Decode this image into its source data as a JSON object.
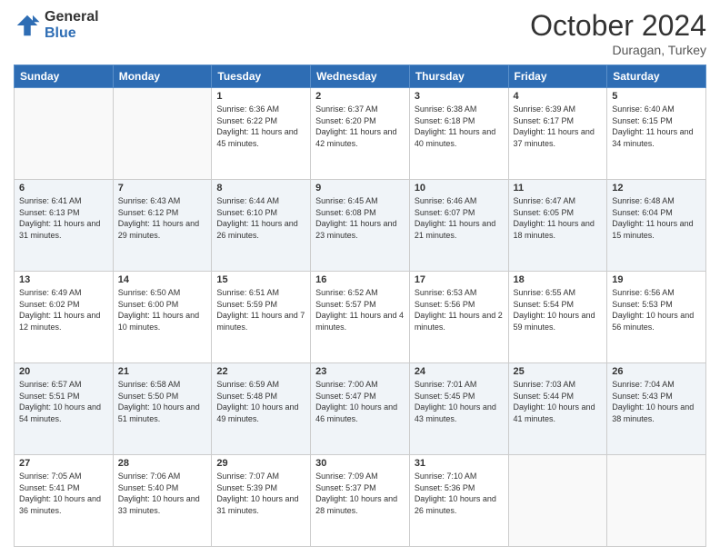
{
  "header": {
    "logo_general": "General",
    "logo_blue": "Blue",
    "title": "October 2024",
    "location": "Duragan, Turkey"
  },
  "days_of_week": [
    "Sunday",
    "Monday",
    "Tuesday",
    "Wednesday",
    "Thursday",
    "Friday",
    "Saturday"
  ],
  "weeks": [
    [
      {
        "day": "",
        "sunrise": "",
        "sunset": "",
        "daylight": ""
      },
      {
        "day": "",
        "sunrise": "",
        "sunset": "",
        "daylight": ""
      },
      {
        "day": "1",
        "sunrise": "Sunrise: 6:36 AM",
        "sunset": "Sunset: 6:22 PM",
        "daylight": "Daylight: 11 hours and 45 minutes."
      },
      {
        "day": "2",
        "sunrise": "Sunrise: 6:37 AM",
        "sunset": "Sunset: 6:20 PM",
        "daylight": "Daylight: 11 hours and 42 minutes."
      },
      {
        "day": "3",
        "sunrise": "Sunrise: 6:38 AM",
        "sunset": "Sunset: 6:18 PM",
        "daylight": "Daylight: 11 hours and 40 minutes."
      },
      {
        "day": "4",
        "sunrise": "Sunrise: 6:39 AM",
        "sunset": "Sunset: 6:17 PM",
        "daylight": "Daylight: 11 hours and 37 minutes."
      },
      {
        "day": "5",
        "sunrise": "Sunrise: 6:40 AM",
        "sunset": "Sunset: 6:15 PM",
        "daylight": "Daylight: 11 hours and 34 minutes."
      }
    ],
    [
      {
        "day": "6",
        "sunrise": "Sunrise: 6:41 AM",
        "sunset": "Sunset: 6:13 PM",
        "daylight": "Daylight: 11 hours and 31 minutes."
      },
      {
        "day": "7",
        "sunrise": "Sunrise: 6:43 AM",
        "sunset": "Sunset: 6:12 PM",
        "daylight": "Daylight: 11 hours and 29 minutes."
      },
      {
        "day": "8",
        "sunrise": "Sunrise: 6:44 AM",
        "sunset": "Sunset: 6:10 PM",
        "daylight": "Daylight: 11 hours and 26 minutes."
      },
      {
        "day": "9",
        "sunrise": "Sunrise: 6:45 AM",
        "sunset": "Sunset: 6:08 PM",
        "daylight": "Daylight: 11 hours and 23 minutes."
      },
      {
        "day": "10",
        "sunrise": "Sunrise: 6:46 AM",
        "sunset": "Sunset: 6:07 PM",
        "daylight": "Daylight: 11 hours and 21 minutes."
      },
      {
        "day": "11",
        "sunrise": "Sunrise: 6:47 AM",
        "sunset": "Sunset: 6:05 PM",
        "daylight": "Daylight: 11 hours and 18 minutes."
      },
      {
        "day": "12",
        "sunrise": "Sunrise: 6:48 AM",
        "sunset": "Sunset: 6:04 PM",
        "daylight": "Daylight: 11 hours and 15 minutes."
      }
    ],
    [
      {
        "day": "13",
        "sunrise": "Sunrise: 6:49 AM",
        "sunset": "Sunset: 6:02 PM",
        "daylight": "Daylight: 11 hours and 12 minutes."
      },
      {
        "day": "14",
        "sunrise": "Sunrise: 6:50 AM",
        "sunset": "Sunset: 6:00 PM",
        "daylight": "Daylight: 11 hours and 10 minutes."
      },
      {
        "day": "15",
        "sunrise": "Sunrise: 6:51 AM",
        "sunset": "Sunset: 5:59 PM",
        "daylight": "Daylight: 11 hours and 7 minutes."
      },
      {
        "day": "16",
        "sunrise": "Sunrise: 6:52 AM",
        "sunset": "Sunset: 5:57 PM",
        "daylight": "Daylight: 11 hours and 4 minutes."
      },
      {
        "day": "17",
        "sunrise": "Sunrise: 6:53 AM",
        "sunset": "Sunset: 5:56 PM",
        "daylight": "Daylight: 11 hours and 2 minutes."
      },
      {
        "day": "18",
        "sunrise": "Sunrise: 6:55 AM",
        "sunset": "Sunset: 5:54 PM",
        "daylight": "Daylight: 10 hours and 59 minutes."
      },
      {
        "day": "19",
        "sunrise": "Sunrise: 6:56 AM",
        "sunset": "Sunset: 5:53 PM",
        "daylight": "Daylight: 10 hours and 56 minutes."
      }
    ],
    [
      {
        "day": "20",
        "sunrise": "Sunrise: 6:57 AM",
        "sunset": "Sunset: 5:51 PM",
        "daylight": "Daylight: 10 hours and 54 minutes."
      },
      {
        "day": "21",
        "sunrise": "Sunrise: 6:58 AM",
        "sunset": "Sunset: 5:50 PM",
        "daylight": "Daylight: 10 hours and 51 minutes."
      },
      {
        "day": "22",
        "sunrise": "Sunrise: 6:59 AM",
        "sunset": "Sunset: 5:48 PM",
        "daylight": "Daylight: 10 hours and 49 minutes."
      },
      {
        "day": "23",
        "sunrise": "Sunrise: 7:00 AM",
        "sunset": "Sunset: 5:47 PM",
        "daylight": "Daylight: 10 hours and 46 minutes."
      },
      {
        "day": "24",
        "sunrise": "Sunrise: 7:01 AM",
        "sunset": "Sunset: 5:45 PM",
        "daylight": "Daylight: 10 hours and 43 minutes."
      },
      {
        "day": "25",
        "sunrise": "Sunrise: 7:03 AM",
        "sunset": "Sunset: 5:44 PM",
        "daylight": "Daylight: 10 hours and 41 minutes."
      },
      {
        "day": "26",
        "sunrise": "Sunrise: 7:04 AM",
        "sunset": "Sunset: 5:43 PM",
        "daylight": "Daylight: 10 hours and 38 minutes."
      }
    ],
    [
      {
        "day": "27",
        "sunrise": "Sunrise: 7:05 AM",
        "sunset": "Sunset: 5:41 PM",
        "daylight": "Daylight: 10 hours and 36 minutes."
      },
      {
        "day": "28",
        "sunrise": "Sunrise: 7:06 AM",
        "sunset": "Sunset: 5:40 PM",
        "daylight": "Daylight: 10 hours and 33 minutes."
      },
      {
        "day": "29",
        "sunrise": "Sunrise: 7:07 AM",
        "sunset": "Sunset: 5:39 PM",
        "daylight": "Daylight: 10 hours and 31 minutes."
      },
      {
        "day": "30",
        "sunrise": "Sunrise: 7:09 AM",
        "sunset": "Sunset: 5:37 PM",
        "daylight": "Daylight: 10 hours and 28 minutes."
      },
      {
        "day": "31",
        "sunrise": "Sunrise: 7:10 AM",
        "sunset": "Sunset: 5:36 PM",
        "daylight": "Daylight: 10 hours and 26 minutes."
      },
      {
        "day": "",
        "sunrise": "",
        "sunset": "",
        "daylight": ""
      },
      {
        "day": "",
        "sunrise": "",
        "sunset": "",
        "daylight": ""
      }
    ]
  ]
}
